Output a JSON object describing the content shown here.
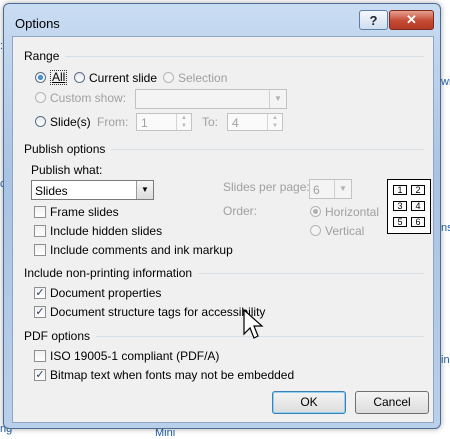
{
  "background": {
    "left_fragments": [
      ":",
      "ce",
      "ng"
    ],
    "right_fragments": [
      "wn",
      "ns",
      "ing"
    ],
    "bottom_fragment": "Mini"
  },
  "dialog": {
    "title": "Options",
    "help_label": "?",
    "close_label": "✕",
    "range": {
      "heading": "Range",
      "all_label": "All",
      "current_slide_label": "Current slide",
      "selection_label": "Selection",
      "custom_show_label": "Custom show:",
      "slides_label": "Slide(s)",
      "from_label": "From:",
      "from_value": "1",
      "to_label": "To:",
      "to_value": "4",
      "selected": "All"
    },
    "publish": {
      "heading": "Publish options",
      "publish_what_label": "Publish what:",
      "publish_what_value": "Slides",
      "frame_slides": {
        "label": "Frame slides",
        "checked": false
      },
      "include_hidden": {
        "label": "Include hidden slides",
        "checked": false
      },
      "include_comments": {
        "label": "Include comments and ink markup",
        "checked": false
      },
      "slides_per_page_label": "Slides per page:",
      "slides_per_page_value": "6",
      "order_label": "Order:",
      "horizontal_label": "Horizontal",
      "vertical_label": "Vertical",
      "order_selected": "Horizontal",
      "preview_numbers": [
        "1",
        "2",
        "3",
        "4",
        "5",
        "6"
      ]
    },
    "nonprinting": {
      "heading": "Include non-printing information",
      "doc_props": {
        "label": "Document properties",
        "checked": true
      },
      "structure_tags": {
        "label": "Document structure tags for accessibility",
        "checked": true
      }
    },
    "pdf": {
      "heading": "PDF options",
      "iso": {
        "label": "ISO 19005-1 compliant (PDF/A)",
        "checked": false
      },
      "bitmap": {
        "label": "Bitmap text when fonts may not be embedded",
        "checked": true
      }
    },
    "ok_label": "OK",
    "cancel_label": "Cancel",
    "check_glyph": "✓"
  }
}
